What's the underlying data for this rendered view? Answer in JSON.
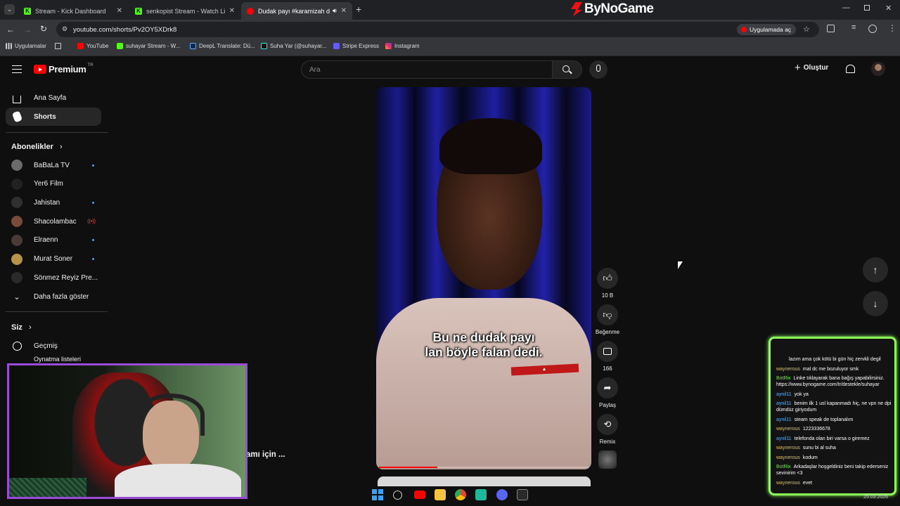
{
  "browser": {
    "tabs": [
      {
        "title": "Stream - Kick Dashboard",
        "active": false
      },
      {
        "title": "senkopist Stream - Watch Live ...",
        "active": false
      },
      {
        "title": "Dudak payı #karamizah de...",
        "active": true
      }
    ],
    "new_tab": "+",
    "brand_logo": "ByNoGame",
    "url": "youtube.com/shorts/Pv2OY5XDrk8",
    "open_in_app": "Uygulamada aç",
    "bookmarks": [
      "Uygulamalar",
      "YouTube",
      "suhayar Stream - W...",
      "DeepL Translate: Dü...",
      "Suha Yar (@suhayar...",
      "Stripe Express",
      "Instagram"
    ]
  },
  "youtube": {
    "logo": "Premium",
    "logo_badge": "TR",
    "search_placeholder": "Ara",
    "create_label": "Oluştur",
    "nav": [
      {
        "label": "Ana Sayfa",
        "icon": "home-icon"
      },
      {
        "label": "Shorts",
        "icon": "shorts-icon",
        "active": true
      }
    ],
    "subscriptions_title": "Abonelikler",
    "subscriptions": [
      {
        "label": "BaBaLa TV",
        "dot": true,
        "color": "#6b6b6b"
      },
      {
        "label": "Yer6 Film",
        "dot": false,
        "color": "#222222"
      },
      {
        "label": "Jahistan",
        "dot": true,
        "color": "#303030"
      },
      {
        "label": "Shacolambac",
        "live": true,
        "color": "#7a4a3a"
      },
      {
        "label": "Elraenn",
        "dot": true,
        "color": "#4a3a38"
      },
      {
        "label": "Murat Soner",
        "dot": true,
        "color": "#b8944a"
      },
      {
        "label": "Sönmez Reyiz Pre...",
        "dot": false,
        "color": "#2a2a2a"
      }
    ],
    "show_more": "Daha fazla göster",
    "you_title": "Siz",
    "you_items": [
      {
        "label": "Geçmiş",
        "icon": "history-icon"
      },
      {
        "label": "Oynatma listeleri",
        "icon": "playlist-icon"
      }
    ],
    "short": {
      "caption_line1": "Bu ne dudak payı",
      "caption_line2": "lan böyle falan dedi.",
      "progress": 0.28,
      "actions": [
        {
          "label": "10 B",
          "icon": "like-icon"
        },
        {
          "label": "Beğenme",
          "icon": "dislike-icon"
        },
        {
          "label": "166",
          "icon": "comment-icon"
        },
        {
          "label": "Paylaş",
          "icon": "share-icon"
        },
        {
          "label": "Remix",
          "icon": "remix-icon"
        }
      ]
    },
    "partial_text": "amı için ..."
  },
  "chat": {
    "messages": [
      {
        "user": "",
        "text": "lazım ama çok kötü bi gün hiç zervkli degil",
        "color": "#ffffff"
      },
      {
        "user": "waynerous",
        "text": "mal dc me bozuluyor smk",
        "color": "#e0c24a"
      },
      {
        "user": "BotRix",
        "text": "Linke tıklayarak bana bağış yapabilirsiniz. https://www.bynogame.com/tr/destekle/suhayar",
        "color": "#53fc18"
      },
      {
        "user": "aynil11",
        "text": "yok ya",
        "color": "#4fb3ff"
      },
      {
        "user": "aynil11",
        "text": "benim ilk 1 usl kapanmadı hiç, ne vpn ne dpi dümdüz giriyodum",
        "color": "#4fb3ff"
      },
      {
        "user": "aynil11",
        "text": "steam speak de toplanalım",
        "color": "#4fb3ff"
      },
      {
        "user": "waynerous",
        "text": "1223336678",
        "color": "#e0c24a"
      },
      {
        "user": "aynil11",
        "text": "telefonda olan biri varsa o giremez",
        "color": "#4fb3ff"
      },
      {
        "user": "waynerous",
        "text": "sunu bi al suha",
        "color": "#e0c24a"
      },
      {
        "user": "waynerous",
        "text": "kodum",
        "color": "#e0c24a"
      },
      {
        "user": "BotRix",
        "text": "Arkadaşlar hoşgeldiniz beni takip ederseniz sevinirim <3",
        "color": "#53fc18"
      },
      {
        "user": "waynerous",
        "text": "evet",
        "color": "#e0c24a"
      }
    ]
  },
  "taskbar": {
    "date": "25.03.2026"
  },
  "colors": {
    "yt_red": "#ff0000",
    "chat_border": "#8cff5a",
    "cam_frame": "#9b4bd8",
    "accent_blue": "#3ea6ff"
  }
}
